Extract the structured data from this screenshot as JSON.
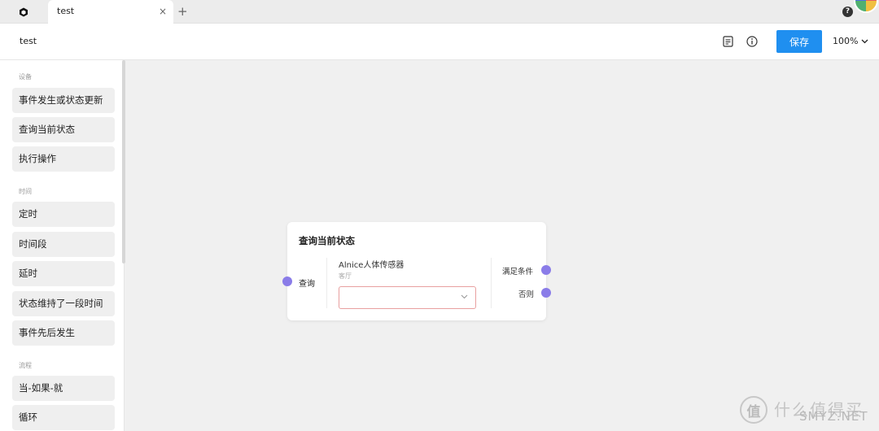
{
  "tabbar": {
    "tab_title": "test",
    "close_glyph": "×",
    "add_glyph": "+",
    "help_glyph": "?"
  },
  "header": {
    "title": "test",
    "save_label": "保存",
    "zoom_label": "100%"
  },
  "sidebar": {
    "sections": [
      {
        "label": "设备",
        "items": [
          "事件发生或状态更新",
          "查询当前状态",
          "执行操作"
        ]
      },
      {
        "label": "时间",
        "items": [
          "定时",
          "时间段",
          "延时",
          "状态维持了一段时间",
          "事件先后发生"
        ]
      },
      {
        "label": "流程",
        "items": [
          "当-如果-就",
          "循环"
        ]
      }
    ]
  },
  "node": {
    "title": "查询当前状态",
    "input_label": "查询",
    "device_name": "Alnice人体传感器",
    "device_room": "客厅",
    "select_value": "",
    "output_true": "满足条件",
    "output_false": "否则"
  },
  "watermark": {
    "logo_char": "值",
    "text": "什么值得买",
    "sub": "SMYZ.NET"
  },
  "colors": {
    "accent": "#1f8ff0",
    "port": "#8a7ce8",
    "select_border": "#e8a0a0"
  }
}
